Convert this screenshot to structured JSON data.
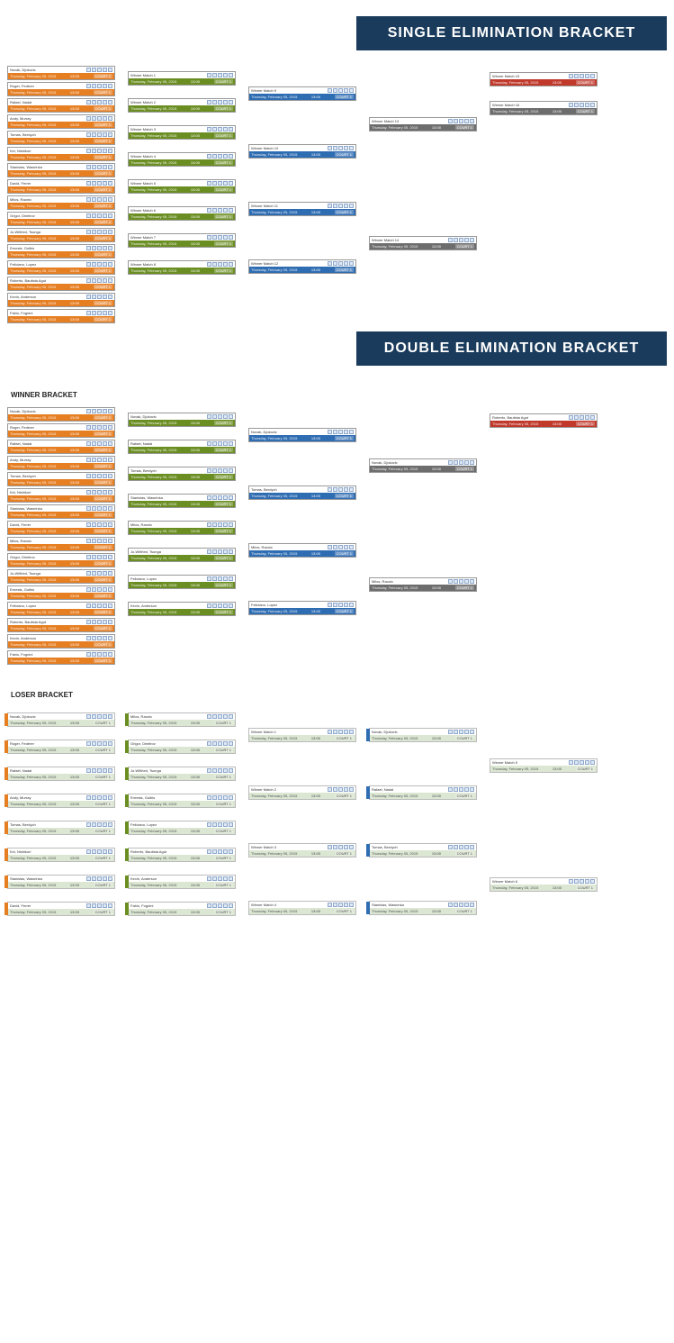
{
  "banners": {
    "single": "SINGLE ELIMINATION BRACKET",
    "double": "DOUBLE ELIMINATION BRACKET"
  },
  "labels": {
    "winner_bracket": "WINNER BRACKET",
    "loser_bracket": "LOSER BRACKET"
  },
  "common": {
    "date": "Thursday, February 05, 2015",
    "time": "13:00",
    "court": "COURT 1",
    "score_box_count": 5,
    "winner_prefix": "Winner Match"
  },
  "players_r1": [
    "Novak, Djokovic",
    "Roger, Federer",
    "Rafael, Nadal",
    "Andy, Murray",
    "Tomas, Berdych",
    "Kei, Nishikori",
    "Stanislas, Wawrinka",
    "David, Ferrer",
    "Milos, Raonic",
    "Grigor, Dimitrov",
    "Jo-Wilfried, Tsonga",
    "Ernests, Gulbis",
    "Feliciano, Lopez",
    "Roberto, Bautista Agut",
    "Kevin, Anderson",
    "Fabio, Fognini"
  ],
  "single": {
    "r32": {
      "color": "c-orange",
      "count": 16,
      "label_seed_prefix": "("
    },
    "r16": {
      "color": "c-green",
      "count": 8
    },
    "qf": {
      "color": "c-blue",
      "count": 4
    },
    "sf": {
      "color": "c-grey",
      "count": 2
    },
    "f": {
      "color": "c-red",
      "count": 2,
      "note": "champion + 3rd place"
    }
  },
  "double_winner": {
    "r1": {
      "color": "c-orange",
      "count": 16
    },
    "r2": {
      "color": "c-green",
      "count": 8
    },
    "r3": {
      "color": "c-blue",
      "count": 4
    },
    "r4": {
      "color": "c-grey",
      "count": 2
    },
    "f": {
      "color": "c-red",
      "count": 1,
      "winner": "Roberto, Bautista Agut"
    }
  },
  "double_loser": {
    "c1": {
      "style": "tab t-orange c-lgreen",
      "count": 8
    },
    "c2": {
      "style": "tab t-green c-lgreen",
      "count": 8
    },
    "c3": {
      "style": "c-lgreen",
      "count": 4,
      "label": "Winner Match"
    },
    "c4": {
      "style": "tab t-blue c-lgreen",
      "count": 4
    },
    "c5": {
      "style": "c-lgreen",
      "count": 2,
      "label": "Winner Match"
    }
  }
}
